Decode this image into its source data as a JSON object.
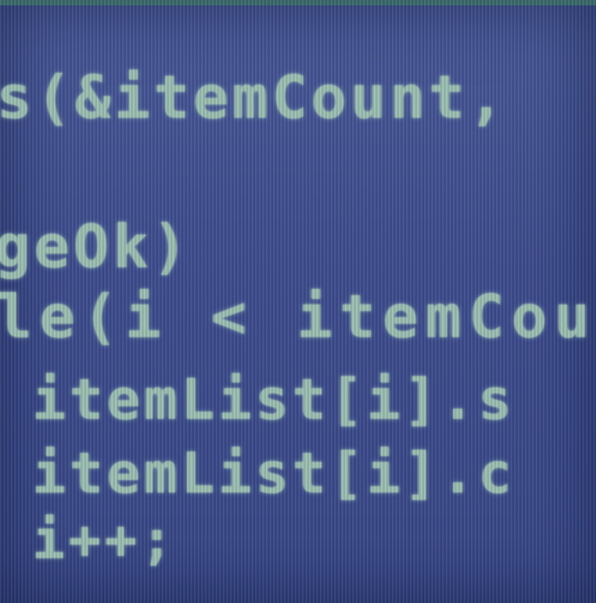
{
  "code": {
    "lines": [
      "s(&itemCount,",
      "geOk)",
      "le(i < itemCou",
      "itemList[i].s",
      "itemList[i].c",
      "i++;"
    ]
  }
}
